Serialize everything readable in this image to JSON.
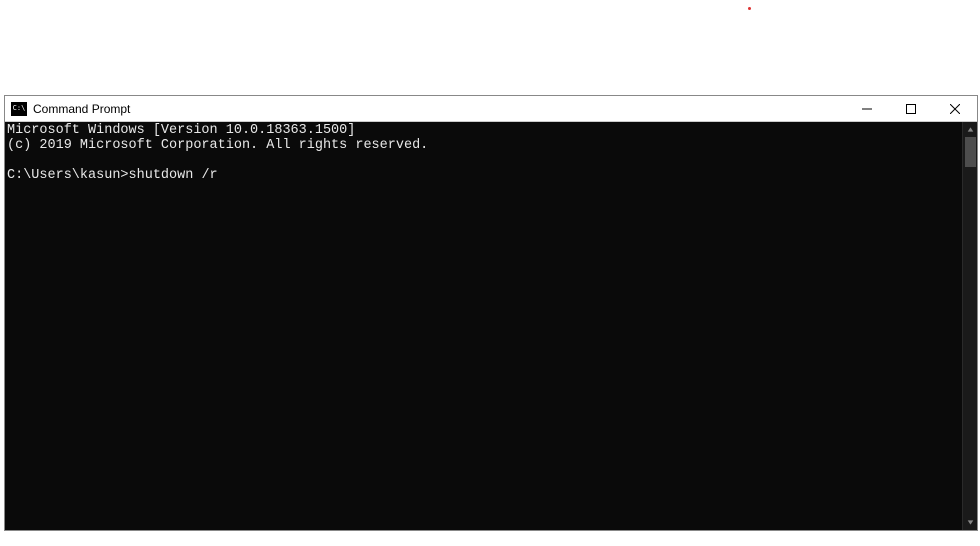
{
  "window": {
    "title": "Command Prompt"
  },
  "console": {
    "line1": "Microsoft Windows [Version 10.0.18363.1500]",
    "line2": "(c) 2019 Microsoft Corporation. All rights reserved.",
    "blank": "",
    "prompt": "C:\\Users\\kasun>",
    "command": "shutdown /r"
  }
}
